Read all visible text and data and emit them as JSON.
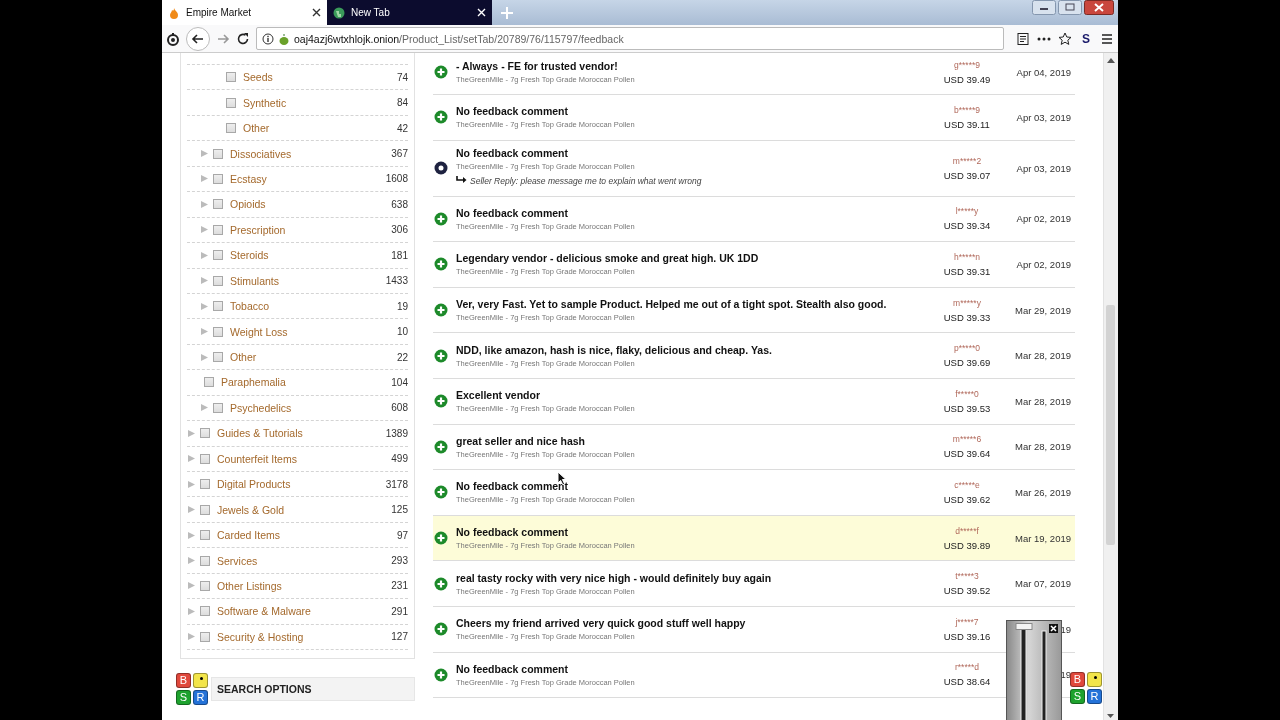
{
  "browser": {
    "tabs": [
      {
        "title": "Empire Market",
        "selected": true
      },
      {
        "title": "New Tab",
        "selected": false
      }
    ],
    "address": {
      "host": "oaj4azj6wtxhlojk.onion",
      "path": "/Product_List/setTab/20789/76/115797/feedback"
    },
    "extension_label": "S"
  },
  "sidebar": {
    "categories": [
      {
        "children": [
          {
            "children": [
              {
                "label": "Seeds",
                "count": "74",
                "checked": false,
                "expandable": false
              },
              {
                "label": "Synthetic",
                "count": "84",
                "checked": false,
                "expandable": false
              },
              {
                "label": "Other",
                "count": "42",
                "checked": false,
                "expandable": false
              }
            ]
          },
          {
            "label": "Dissociatives",
            "count": "367",
            "checked": false,
            "expandable": true
          },
          {
            "label": "Ecstasy",
            "count": "1608",
            "checked": false,
            "expandable": true
          },
          {
            "label": "Opioids",
            "count": "638",
            "checked": false,
            "expandable": true
          },
          {
            "label": "Prescription",
            "count": "306",
            "checked": false,
            "expandable": true
          },
          {
            "label": "Steroids",
            "count": "181",
            "checked": false,
            "expandable": true
          },
          {
            "label": "Stimulants",
            "count": "1433",
            "checked": false,
            "expandable": true
          },
          {
            "label": "Tobacco",
            "count": "19",
            "checked": false,
            "expandable": true
          },
          {
            "label": "Weight Loss",
            "count": "10",
            "checked": false,
            "expandable": true
          },
          {
            "label": "Other",
            "count": "22",
            "checked": false,
            "expandable": true
          },
          {
            "label": "Paraphemalia",
            "count": "104",
            "checked": false,
            "expandable": false,
            "shallow": true
          },
          {
            "label": "Psychedelics",
            "count": "608",
            "checked": false,
            "expandable": true
          }
        ]
      },
      {
        "label": "Guides & Tutorials",
        "count": "1389",
        "checked": false,
        "expandable": true
      },
      {
        "label": "Counterfeit Items",
        "count": "499",
        "checked": false,
        "expandable": true
      },
      {
        "label": "Digital Products",
        "count": "3178",
        "checked": false,
        "expandable": true
      },
      {
        "label": "Jewels & Gold",
        "count": "125",
        "checked": false,
        "expandable": true
      },
      {
        "label": "Carded Items",
        "count": "97",
        "checked": false,
        "expandable": true
      },
      {
        "label": "Services",
        "count": "293",
        "checked": false,
        "expandable": true
      },
      {
        "label": "Other Listings",
        "count": "231",
        "checked": false,
        "expandable": true
      },
      {
        "label": "Software & Malware",
        "count": "291",
        "checked": false,
        "expandable": true
      },
      {
        "label": "Security & Hosting",
        "count": "127",
        "checked": false,
        "expandable": true
      }
    ],
    "search_options": {
      "title": "SEARCH OPTIONS",
      "tiles": [
        {
          "kind": "letter",
          "text": "B",
          "color": "#e0483c"
        },
        {
          "kind": "dot",
          "color": "#f3e54a"
        },
        {
          "kind": "letter",
          "text": "S",
          "color": "#1ea22e"
        },
        {
          "kind": "letter",
          "text": "R",
          "color": "#2472d8"
        }
      ]
    }
  },
  "feedback": [
    {
      "kind": "positive",
      "comment": "- Always - FE for trusted vendor!",
      "product": "TheGreenMile - 7g Fresh Top Grade Moroccan Pollen",
      "buyer": "g*****9",
      "price": "USD 39.49",
      "date": "Apr 04, 2019",
      "highlighted": false
    },
    {
      "kind": "positive",
      "comment": "No feedback comment",
      "product": "TheGreenMile - 7g Fresh Top Grade Moroccan Pollen",
      "buyer": "b*****9",
      "price": "USD 39.11",
      "date": "Apr 03, 2019",
      "highlighted": false
    },
    {
      "kind": "neutral",
      "comment": "No feedback comment",
      "product": "TheGreenMile - 7g Fresh Top Grade Moroccan Pollen",
      "seller_reply": "Seller Reply: please message me to explain what went wrong",
      "buyer": "m*****2",
      "price": "USD 39.07",
      "date": "Apr 03, 2019",
      "highlighted": false
    },
    {
      "kind": "positive",
      "comment": "No feedback comment",
      "product": "TheGreenMile - 7g Fresh Top Grade Moroccan Pollen",
      "buyer": "l*****y",
      "price": "USD 39.34",
      "date": "Apr 02, 2019",
      "highlighted": false
    },
    {
      "kind": "positive",
      "comment": "Legendary vendor - delicious smoke and great high. UK 1DD",
      "product": "TheGreenMile - 7g Fresh Top Grade Moroccan Pollen",
      "buyer": "h*****n",
      "price": "USD 39.31",
      "date": "Apr 02, 2019",
      "highlighted": false
    },
    {
      "kind": "positive",
      "comment": "Ver, very Fast. Yet to sample Product. Helped me out of a tight spot. Stealth also good.",
      "product": "TheGreenMile - 7g Fresh Top Grade Moroccan Pollen",
      "buyer": "m*****y",
      "price": "USD 39.33",
      "date": "Mar 29, 2019",
      "highlighted": false
    },
    {
      "kind": "positive",
      "comment": "NDD, like amazon, hash is nice, flaky, delicious and cheap. Yas.",
      "product": "TheGreenMile - 7g Fresh Top Grade Moroccan Pollen",
      "buyer": "p*****0",
      "price": "USD 39.69",
      "date": "Mar 28, 2019",
      "highlighted": false
    },
    {
      "kind": "positive",
      "comment": "Excellent vendor",
      "product": "TheGreenMile - 7g Fresh Top Grade Moroccan Pollen",
      "buyer": "f*****0",
      "price": "USD 39.53",
      "date": "Mar 28, 2019",
      "highlighted": false
    },
    {
      "kind": "positive",
      "comment": "great seller and nice hash",
      "product": "TheGreenMile - 7g Fresh Top Grade Moroccan Pollen",
      "buyer": "m*****6",
      "price": "USD 39.64",
      "date": "Mar 28, 2019",
      "highlighted": false
    },
    {
      "kind": "positive",
      "comment": "No feedback comment",
      "product": "TheGreenMile - 7g Fresh Top Grade Moroccan Pollen",
      "buyer": "c*****e",
      "price": "USD 39.62",
      "date": "Mar 26, 2019",
      "highlighted": false
    },
    {
      "kind": "positive",
      "comment": "No feedback comment",
      "product": "TheGreenMile - 7g Fresh Top Grade Moroccan Pollen",
      "buyer": "d*****f",
      "price": "USD 39.89",
      "date": "Mar 19, 2019",
      "highlighted": true
    },
    {
      "kind": "positive",
      "comment": "real tasty rocky with very nice high - would definitely buy again",
      "product": "TheGreenMile - 7g Fresh Top Grade Moroccan Pollen",
      "buyer": "t*****3",
      "price": "USD 39.52",
      "date": "Mar 07, 2019",
      "highlighted": false
    },
    {
      "kind": "positive",
      "comment": "Cheers my friend arrived very quick good stuff well happy",
      "product": "TheGreenMile - 7g Fresh Top Grade Moroccan Pollen",
      "buyer": "j*****7",
      "price": "USD 39.16",
      "date": "19",
      "highlighted": false
    },
    {
      "kind": "positive",
      "comment": "No feedback comment",
      "product": "TheGreenMile - 7g Fresh Top Grade Moroccan Pollen",
      "buyer": "r*****d",
      "price": "USD 38.64",
      "date": "19",
      "highlighted": false
    }
  ],
  "corner_tiles": [
    {
      "kind": "letter",
      "text": "B",
      "color": "#e0483c"
    },
    {
      "kind": "dot",
      "color": "#f3e54a"
    },
    {
      "kind": "letter",
      "text": "S",
      "color": "#1ea22e"
    },
    {
      "kind": "letter",
      "text": "R",
      "color": "#2472d8"
    }
  ]
}
